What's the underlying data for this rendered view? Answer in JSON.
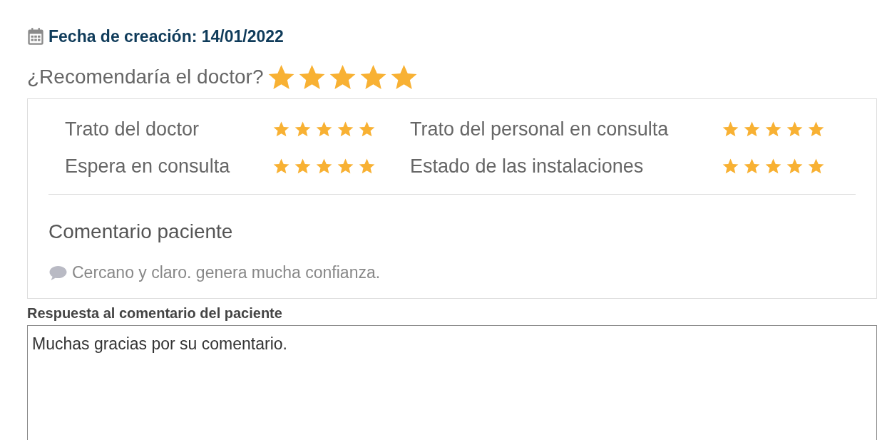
{
  "created": {
    "label": "Fecha de creación: 14/01/2022"
  },
  "recommend": {
    "question": "¿Recomendaría el doctor?",
    "stars": 5
  },
  "ratings": [
    {
      "label": "Trato del doctor",
      "stars": 5
    },
    {
      "label": "Trato del personal en consulta",
      "stars": 5
    },
    {
      "label": "Espera en consulta",
      "stars": 5
    },
    {
      "label": "Estado de las instalaciones",
      "stars": 5
    }
  ],
  "comment": {
    "title": "Comentario paciente",
    "text": "Cercano y claro. genera mucha confianza."
  },
  "reply": {
    "label": "Respuesta al comentario del paciente",
    "value": "Muchas gracias por su comentario."
  }
}
